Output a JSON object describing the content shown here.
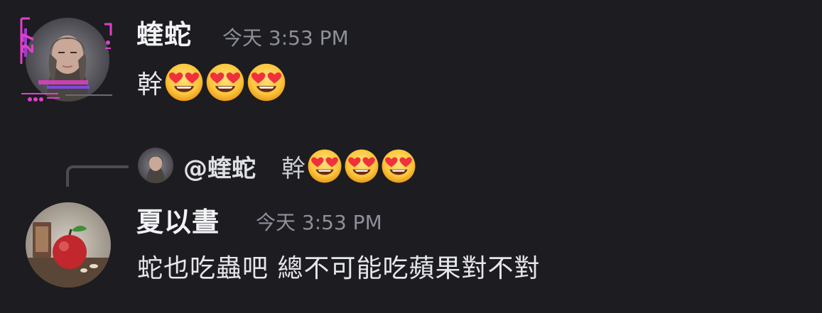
{
  "messages": [
    {
      "author": "蝰蛇",
      "timestamp": "今天 3:53 PM",
      "text": "幹",
      "emoji": "heart-eyes-emoji",
      "emoji_count": 3
    },
    {
      "author": "夏以晝",
      "timestamp": "今天 3:53 PM",
      "text": "蛇也吃蟲吧 總不可能吃蘋果對不對",
      "reply": {
        "mention": "@蝰蛇",
        "text": "幹",
        "emoji": "heart-eyes-emoji",
        "emoji_count": 3
      }
    }
  ],
  "colors": {
    "background": "#1c1c21",
    "username": "#f2f3f5",
    "timestamp": "#8e9099",
    "message": "#e6e7ea",
    "reply_line": "#4b4d55",
    "frame_accent": "#e040c8"
  }
}
